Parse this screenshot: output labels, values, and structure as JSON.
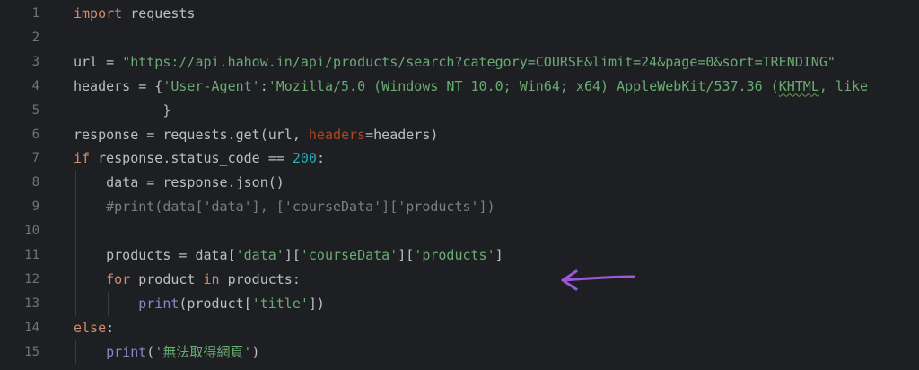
{
  "editor": {
    "colors": {
      "background": "#1e1f22",
      "keyword": "#cf8e6d",
      "string": "#6aab73",
      "number": "#2aacb8",
      "comment": "#7a7e85",
      "parameter": "#aa4926",
      "text": "#bcbec4",
      "arrow": "#9b59d6"
    },
    "line_numbers": [
      "1",
      "2",
      "3",
      "4",
      "5",
      "6",
      "7",
      "8",
      "9",
      "10",
      "11",
      "12",
      "13",
      "14",
      "15"
    ],
    "lines": [
      {
        "tokens": [
          {
            "t": "kw",
            "v": "import"
          },
          {
            "t": "txt",
            "v": " requests"
          }
        ]
      },
      {
        "tokens": []
      },
      {
        "tokens": [
          {
            "t": "txt",
            "v": "url = "
          },
          {
            "t": "str",
            "v": "\"https://api.hahow.in/api/products/search?category=COURSE&limit=24&page=0&sort=TRENDING\""
          }
        ]
      },
      {
        "tokens": [
          {
            "t": "txt",
            "v": "headers = {"
          },
          {
            "t": "str",
            "v": "'User-Agent'"
          },
          {
            "t": "txt",
            "v": ":"
          },
          {
            "t": "str",
            "v": "'Mozilla/5.0 (Windows NT 10.0; Win64; x64) AppleWebKit/537.36 ("
          },
          {
            "t": "str_sq",
            "v": "KHTML"
          },
          {
            "t": "str",
            "v": ", like"
          }
        ]
      },
      {
        "tokens": [
          {
            "t": "txt",
            "v": "           }"
          }
        ]
      },
      {
        "tokens": [
          {
            "t": "txt",
            "v": "response = requests.get(url, "
          },
          {
            "t": "param",
            "v": "headers"
          },
          {
            "t": "txt",
            "v": "=headers)"
          }
        ]
      },
      {
        "tokens": [
          {
            "t": "kw",
            "v": "if"
          },
          {
            "t": "txt",
            "v": " response.status_code == "
          },
          {
            "t": "num",
            "v": "200"
          },
          {
            "t": "txt",
            "v": ":"
          }
        ]
      },
      {
        "tokens": [
          {
            "t": "txt",
            "v": "    data = response.json()"
          }
        ]
      },
      {
        "tokens": [
          {
            "t": "cm",
            "v": "    #print(data['data'], ['courseData']['products'])"
          }
        ]
      },
      {
        "tokens": []
      },
      {
        "tokens": [
          {
            "t": "txt",
            "v": "    products = data["
          },
          {
            "t": "str",
            "v": "'data'"
          },
          {
            "t": "txt",
            "v": "]["
          },
          {
            "t": "str",
            "v": "'courseData'"
          },
          {
            "t": "txt",
            "v": "]["
          },
          {
            "t": "str",
            "v": "'products'"
          },
          {
            "t": "txt",
            "v": "]"
          }
        ]
      },
      {
        "tokens": [
          {
            "t": "txt",
            "v": "    "
          },
          {
            "t": "kw",
            "v": "for"
          },
          {
            "t": "txt",
            "v": " product "
          },
          {
            "t": "kw",
            "v": "in"
          },
          {
            "t": "txt",
            "v": " products:"
          }
        ]
      },
      {
        "tokens": [
          {
            "t": "txt",
            "v": "        "
          },
          {
            "t": "builtin",
            "v": "print"
          },
          {
            "t": "txt",
            "v": "(product["
          },
          {
            "t": "str",
            "v": "'title'"
          },
          {
            "t": "txt",
            "v": "])"
          }
        ]
      },
      {
        "tokens": [
          {
            "t": "kw",
            "v": "else"
          },
          {
            "t": "txt",
            "v": ":"
          }
        ]
      },
      {
        "tokens": [
          {
            "t": "txt",
            "v": "    "
          },
          {
            "t": "builtin",
            "v": "print"
          },
          {
            "t": "txt",
            "v": "("
          },
          {
            "t": "str",
            "v": "'無法取得網頁'"
          },
          {
            "t": "txt",
            "v": ")"
          }
        ]
      }
    ],
    "annotation": {
      "icon": "left-arrow-icon"
    }
  }
}
